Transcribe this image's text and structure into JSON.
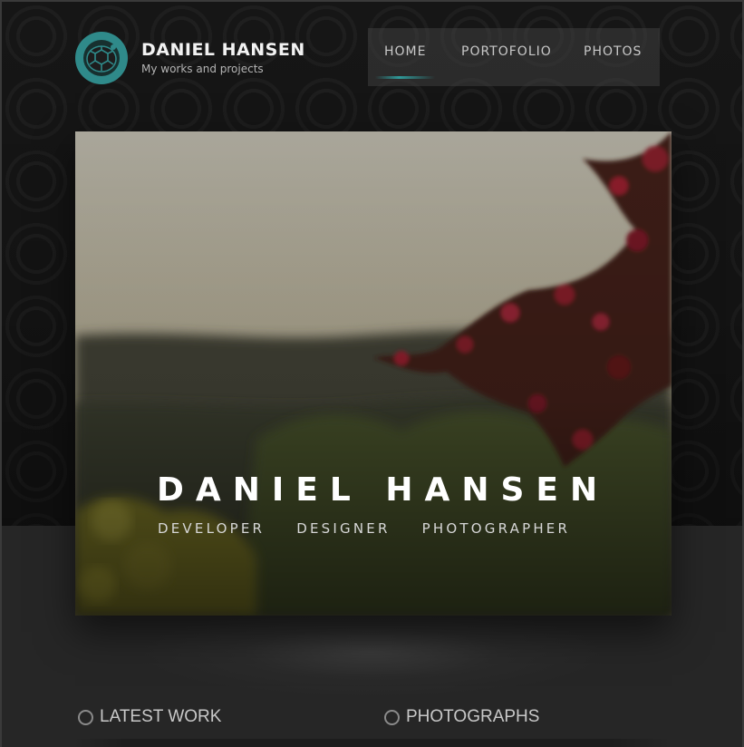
{
  "brand": {
    "name": "DANIEL HANSEN",
    "tagline": "My works and projects"
  },
  "nav": {
    "items": [
      {
        "label": "HOME",
        "active": true
      },
      {
        "label": "PORTOFOLIO",
        "active": false
      },
      {
        "label": "PHOTOS",
        "active": false
      }
    ]
  },
  "hero": {
    "title": "DANIEL HANSEN",
    "roles": [
      "DEVELOPER",
      "DESIGNER",
      "PHOTOGRAPHER"
    ]
  },
  "sections": {
    "latest_work": "LATEST WORK",
    "photographs": "PHOTOGRAPHS"
  },
  "colors": {
    "accent": "#2f8a8a",
    "background": "#1a1a1a"
  },
  "icons": {
    "logo": "turtle-shell-logo-icon",
    "section_bullet": "circle-icon"
  }
}
